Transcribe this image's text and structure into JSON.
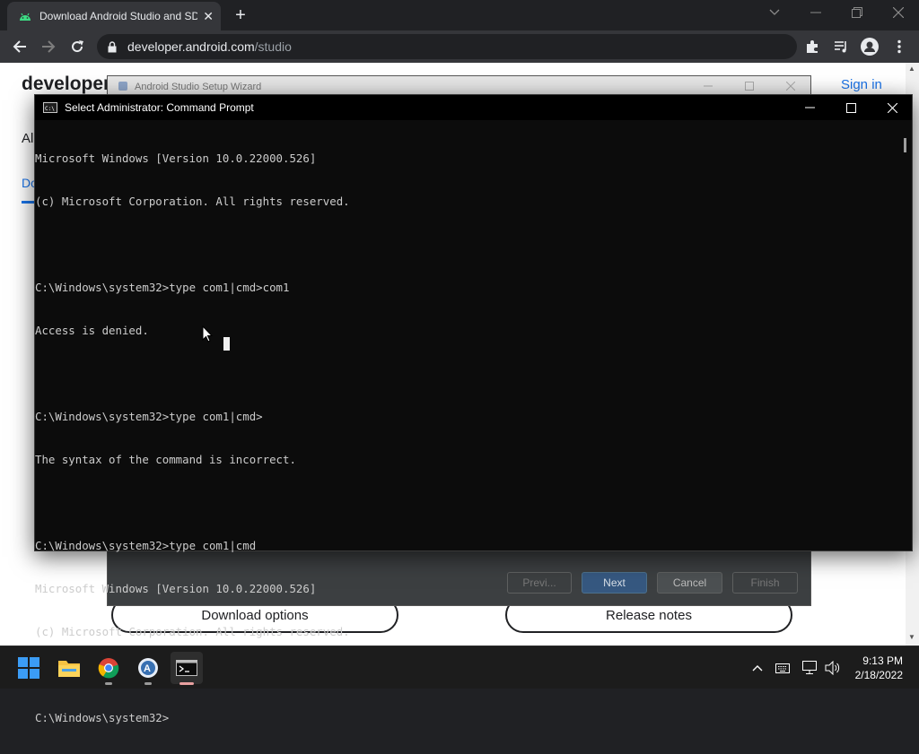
{
  "browser": {
    "tab_title": "Download Android Studio and SDK tools",
    "url_host": "developer.android.com",
    "url_path": "/studio"
  },
  "page": {
    "brand": "developers",
    "sign_in": "Sign in",
    "peek_a": "Al",
    "peek_d": "Do",
    "download_options": "Download options",
    "release_notes": "Release notes"
  },
  "wizard": {
    "title": "Android Studio Setup Wizard",
    "buttons": {
      "prev": "Previ...",
      "next": "Next",
      "cancel": "Cancel",
      "finish": "Finish"
    }
  },
  "cmd": {
    "title": "Select Administrator: Command Prompt",
    "lines": [
      "Microsoft Windows [Version 10.0.22000.526]",
      "(c) Microsoft Corporation. All rights reserved.",
      "",
      "C:\\Windows\\system32>type com1|cmd>com1",
      "Access is denied.",
      "",
      "C:\\Windows\\system32>type com1|cmd>",
      "The syntax of the command is incorrect.",
      "",
      "C:\\Windows\\system32>type com1|cmd",
      "Microsoft Windows [Version 10.0.22000.526]",
      "(c) Microsoft Corporation. All rights reserved.",
      "",
      "C:\\Windows\\system32>"
    ]
  },
  "taskbar": {
    "time": "9:13 PM",
    "date": "2/18/2022",
    "apps": [
      "windows-start-icon",
      "file-explorer-icon",
      "chrome-icon",
      "android-studio-icon",
      "command-prompt-icon"
    ]
  },
  "colors": {
    "chrome_dark": "#202124",
    "chrome_toolbar": "#35363a",
    "link_blue": "#1a73e8",
    "cmd_bg": "#0c0c0c",
    "cmd_text": "#cccccc",
    "wizard_primary": "#365880",
    "win_blue": "#3b9cf5"
  }
}
